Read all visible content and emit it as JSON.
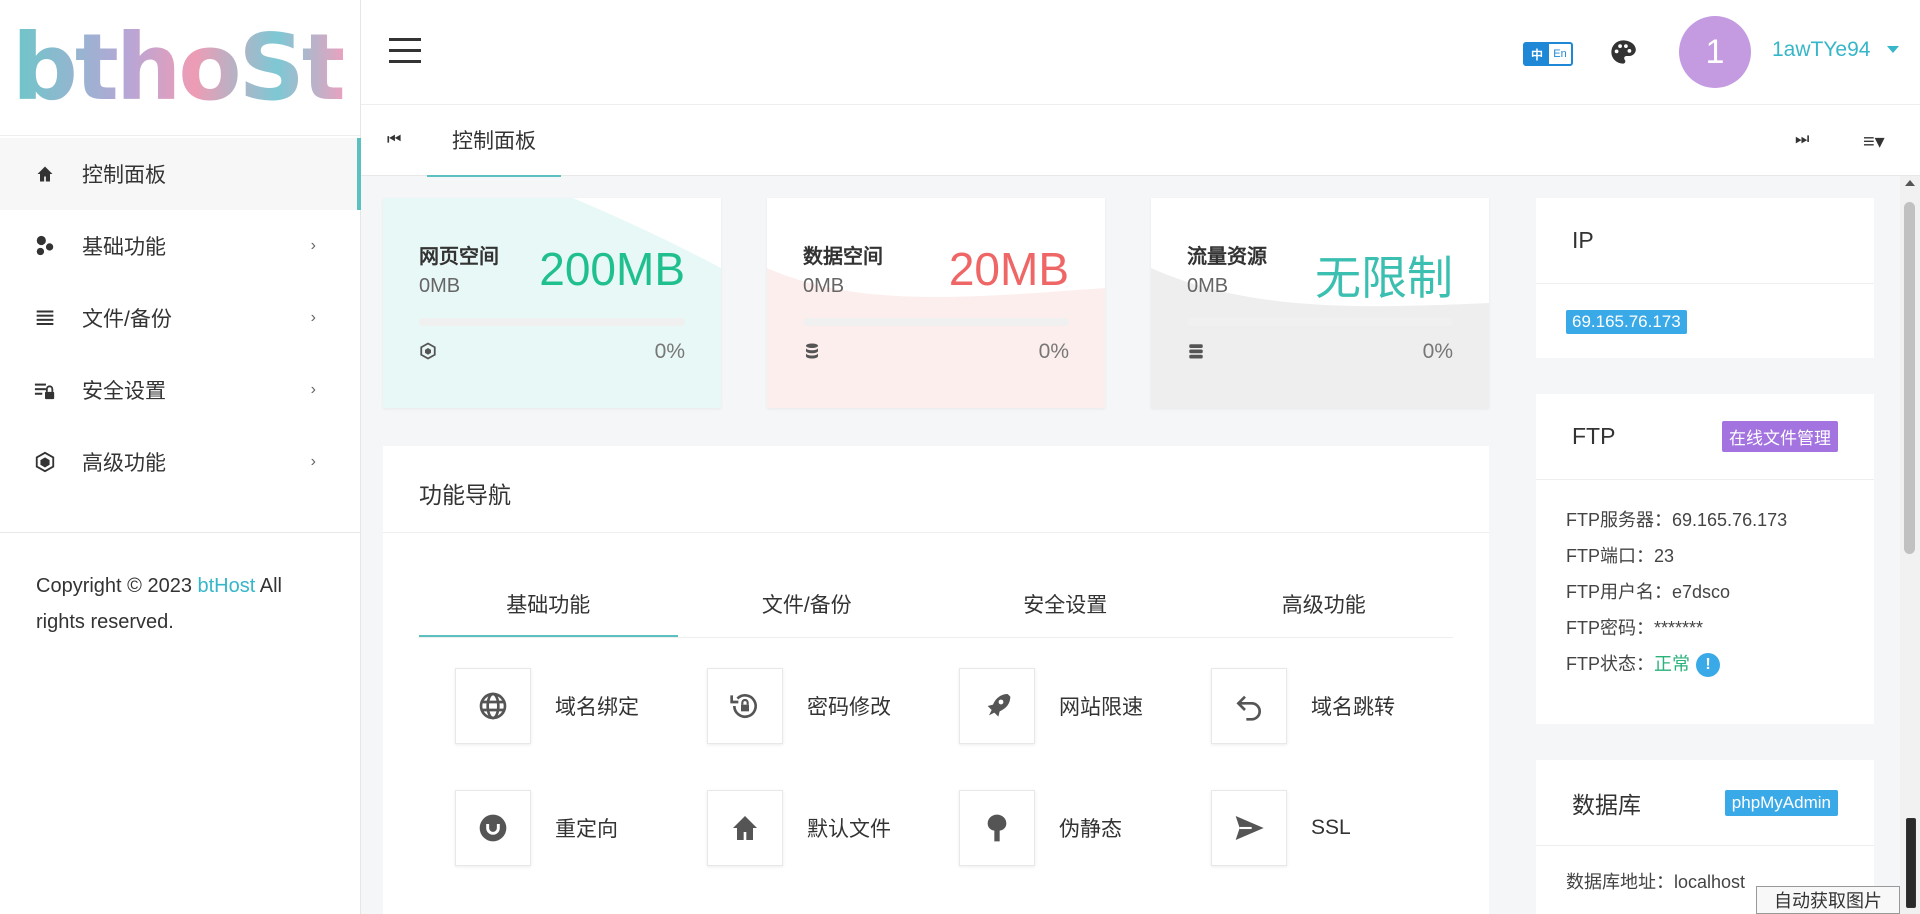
{
  "logo": {
    "text": "bthoSt"
  },
  "sidebar": {
    "items": [
      {
        "label": "控制面板",
        "icon": "home-icon",
        "active": true
      },
      {
        "label": "基础功能",
        "icon": "circles-icon",
        "arrow": "›"
      },
      {
        "label": "文件/备份",
        "icon": "list-icon",
        "arrow": "›"
      },
      {
        "label": "安全设置",
        "icon": "lock-settings-icon",
        "arrow": "›"
      },
      {
        "label": "高级功能",
        "icon": "cube-icon",
        "arrow": "›"
      }
    ],
    "copyright_prefix": "Copyright © 2023 ",
    "copyright_brand": "btHost",
    "copyright_suffix": " All rights reserved."
  },
  "header": {
    "lang_zh": "中",
    "lang_en": "En",
    "avatar_text": "1",
    "username": "1awTYe94"
  },
  "tabs": {
    "active": "控制面板"
  },
  "stats": [
    {
      "title": "网页空间",
      "used": "0MB",
      "total": "200MB",
      "percent": "0%",
      "color": "#20c08e",
      "bg": "#e8f8f6"
    },
    {
      "title": "数据空间",
      "used": "0MB",
      "total": "20MB",
      "percent": "0%",
      "color": "#ef6666",
      "bg": "#fdeeee"
    },
    {
      "title": "流量资源",
      "used": "0MB",
      "total": "无限制",
      "percent": "0%",
      "color": "#3bbfb0",
      "bg": "#eeeeee"
    }
  ],
  "features": {
    "title": "功能导航",
    "tabs": [
      "基础功能",
      "文件/备份",
      "安全设置",
      "高级功能"
    ],
    "items": [
      {
        "label": "域名绑定",
        "icon": "globe-icon"
      },
      {
        "label": "密码修改",
        "icon": "lock-reset-icon"
      },
      {
        "label": "网站限速",
        "icon": "rocket-icon"
      },
      {
        "label": "域名跳转",
        "icon": "undo-icon"
      },
      {
        "label": "重定向",
        "icon": "redirect-icon"
      },
      {
        "label": "默认文件",
        "icon": "home-icon"
      },
      {
        "label": "伪静态",
        "icon": "tree-icon"
      },
      {
        "label": "SSL",
        "icon": "send-icon"
      }
    ]
  },
  "ip_card": {
    "title": "IP",
    "ip": "69.165.76.173"
  },
  "ftp_card": {
    "title": "FTP",
    "badge": "在线文件管理",
    "server_label": "FTP服务器：",
    "server": "69.165.76.173",
    "port_label": "FTP端口：",
    "port": "23",
    "user_label": "FTP用户名：",
    "user": "e7dsco",
    "pass_label": "FTP密码：",
    "pass": "*******",
    "status_label": "FTP状态：",
    "status": "正常",
    "info": "!"
  },
  "db_card": {
    "title": "数据库",
    "badge": "phpMyAdmin",
    "addr_label": "数据库地址：",
    "addr": "localhost"
  },
  "auto_fetch": "自动获取图片",
  "colors": {
    "accent": "#5bc0bf",
    "link": "#36b6c9",
    "purple": "#a373e0",
    "blue": "#3aa9e8"
  }
}
